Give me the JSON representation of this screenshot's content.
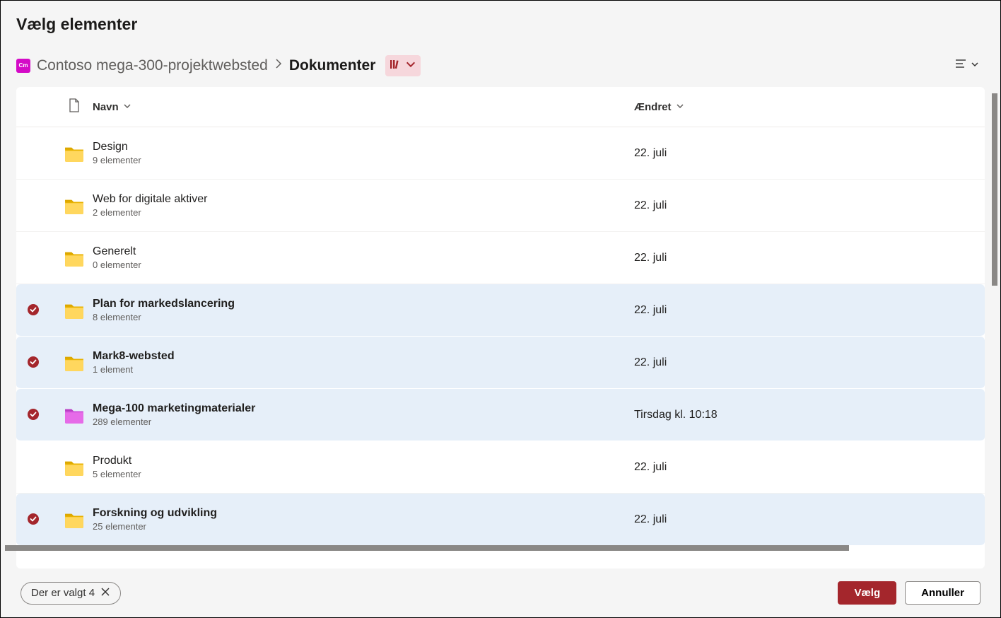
{
  "dialog": {
    "title": "Vælg elementer"
  },
  "breadcrumb": {
    "site_tile_text": "Cm",
    "site_name": "Contoso mega-300-projektwebsted",
    "current": "Dokumenter"
  },
  "columns": {
    "name": "Navn",
    "modified": "Ændret"
  },
  "items": [
    {
      "name": "Design",
      "sub": "9 elementer",
      "modified": "22. juli",
      "selected": false,
      "folder_color": "yellow"
    },
    {
      "name": "Web for digitale aktiver",
      "sub": "2 elementer",
      "modified": "22. juli",
      "selected": false,
      "folder_color": "yellow"
    },
    {
      "name": "Generelt",
      "sub": "0 elementer",
      "modified": "22. juli",
      "selected": false,
      "folder_color": "yellow"
    },
    {
      "name": "Plan for markedslancering",
      "sub": "8 elementer",
      "modified": "22. juli",
      "selected": true,
      "folder_color": "yellow"
    },
    {
      "name": "Mark8-websted",
      "sub": "1 element",
      "modified": "22. juli",
      "selected": true,
      "folder_color": "yellow"
    },
    {
      "name": "Mega-100 marketingmaterialer",
      "sub": "289 elementer",
      "modified": "Tirsdag kl. 10:18",
      "selected": true,
      "folder_color": "pink"
    },
    {
      "name": "Produkt",
      "sub": "5 elementer",
      "modified": "22. juli",
      "selected": false,
      "folder_color": "yellow"
    },
    {
      "name": "Forskning og udvikling",
      "sub": "25 elementer",
      "modified": "22. juli",
      "selected": true,
      "folder_color": "yellow"
    }
  ],
  "footer": {
    "selection_text": "Der er valgt 4",
    "select_label": "Vælg",
    "cancel_label": "Annuller"
  }
}
